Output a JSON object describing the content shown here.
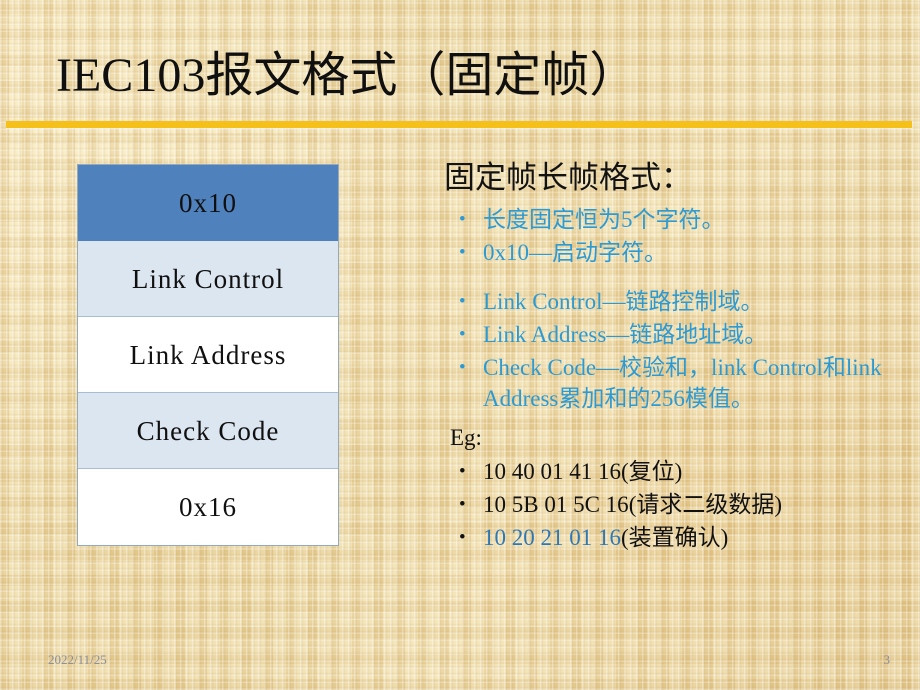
{
  "slide": {
    "title": "IEC103报文格式（固定帧）",
    "accent_color": "#f5c01a",
    "background_color": "#ecd9a4"
  },
  "frame_table": {
    "header_fill": "#4f81bd",
    "alt_fill": "#dce6f1",
    "plain_fill": "#ffffff",
    "rows": [
      {
        "label": "0x10"
      },
      {
        "label": "Link Control"
      },
      {
        "label": "Link Address"
      },
      {
        "label": "Check Code"
      },
      {
        "label": "0x16"
      }
    ]
  },
  "detail": {
    "heading": "固定帧长帧格式：",
    "bullets": [
      {
        "text": "长度固定恒为5个字符。"
      },
      {
        "text": "0x10—启动字符。"
      },
      {
        "text": "Link Control—链路控制域。"
      },
      {
        "text": "Link Address—链路地址域。"
      },
      {
        "text": "Check Code—校验和，link Control和link Address累加和的256模值。"
      }
    ],
    "examples_label": "Eg:",
    "examples": [
      {
        "code": "10 40 01 41 16",
        "note": "(复位)"
      },
      {
        "code": "10 5B 01 5C 16",
        "note": "(请求二级数据)"
      },
      {
        "code": "10 20 21 01 16",
        "note": "(装置确认)"
      }
    ]
  },
  "footer": {
    "date": "2022/11/25",
    "page": "3"
  }
}
